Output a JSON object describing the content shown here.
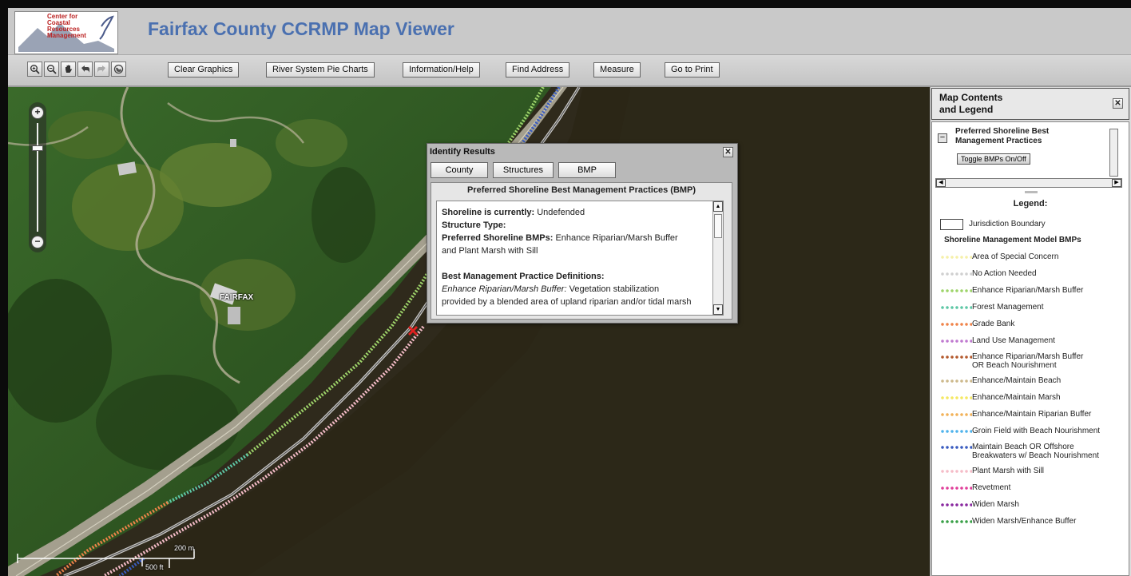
{
  "header": {
    "title": "Fairfax County CCRMP Map Viewer",
    "logo_lines": [
      "Center for",
      "Coastal",
      "Resources",
      "Management"
    ]
  },
  "toolbar": {
    "icons": [
      "zoom-in-icon",
      "zoom-out-icon",
      "pan-hand-icon",
      "back-arrow-icon",
      "forward-arrow-icon",
      "full-extent-icon"
    ],
    "buttons": [
      "Clear Graphics",
      "River System Pie Charts",
      "Information/Help",
      "Find Address",
      "Measure",
      "Go to Print"
    ]
  },
  "map": {
    "place_label": "FAIRFAX",
    "zoom_plus": "+",
    "zoom_minus": "−",
    "scale_top": "200 m",
    "scale_bottom": "500 ft"
  },
  "identify": {
    "title": "Identify Results",
    "tabs": [
      "County",
      "Structures",
      "BMP"
    ],
    "panel_title": "Preferred Shoreline Best Management Practices (BMP)",
    "shoreline_label": "Shoreline is currently:",
    "shoreline_value": "Undefended",
    "structure_label": "Structure Type:",
    "bmp_label": "Preferred Shoreline BMPs:",
    "bmp_value_1": "Enhance Riparian/Marsh Buffer",
    "bmp_value_2": "and Plant Marsh with Sill",
    "definitions_heading": "Best Management Practice Definitions:",
    "def_term": "Enhance Riparian/Marsh Buffer:",
    "def_text_1": "Vegetation stabilization",
    "def_text_2": "provided by a blended area of upland riparian and/or tidal marsh"
  },
  "legend_panel": {
    "title_line1": "Map Contents",
    "title_line2": "and Legend",
    "layer_name_1": "Preferred Shoreline Best",
    "layer_name_2": "Management Practices",
    "toggle_label": "Toggle BMPs On/Off",
    "legend_title": "Legend:",
    "jurisdiction_label": "Jurisdiction Boundary",
    "group_title": "Shoreline Management Model BMPs",
    "items": [
      {
        "label": "Area of Special Concern",
        "color": "#f5f0a8"
      },
      {
        "label": "No Action Needed",
        "color": "#d0d0d0"
      },
      {
        "label": "Enhance Riparian/Marsh Buffer",
        "color": "#9ed46a"
      },
      {
        "label": "Forest Management",
        "color": "#5ec7a6"
      },
      {
        "label": "Grade Bank",
        "color": "#f0844a"
      },
      {
        "label": "Land Use Management",
        "color": "#c07ad0"
      },
      {
        "label": "Enhance Riparian/Marsh Buffer",
        "label2": "OR Beach Nourishment",
        "color": "#b45a2e"
      },
      {
        "label": "Enhance/Maintain Beach",
        "color": "#cdb98c"
      },
      {
        "label": "Enhance/Maintain Marsh",
        "color": "#f5e862"
      },
      {
        "label": "Enhance/Maintain Riparian Buffer",
        "color": "#f2b25a"
      },
      {
        "label": "Groin Field with Beach Nourishment",
        "color": "#50b4ec"
      },
      {
        "label": "Maintain Beach OR Offshore",
        "label2": "Breakwaters w/ Beach Nourishment",
        "color": "#3a5cc0"
      },
      {
        "label": "Plant Marsh with Sill",
        "color": "#f5bcc8"
      },
      {
        "label": "Revetment",
        "color": "#e0409a"
      },
      {
        "label": "Widen Marsh",
        "color": "#8a2aa0"
      },
      {
        "label": "Widen Marsh/Enhance Buffer",
        "color": "#3aa048"
      }
    ]
  }
}
